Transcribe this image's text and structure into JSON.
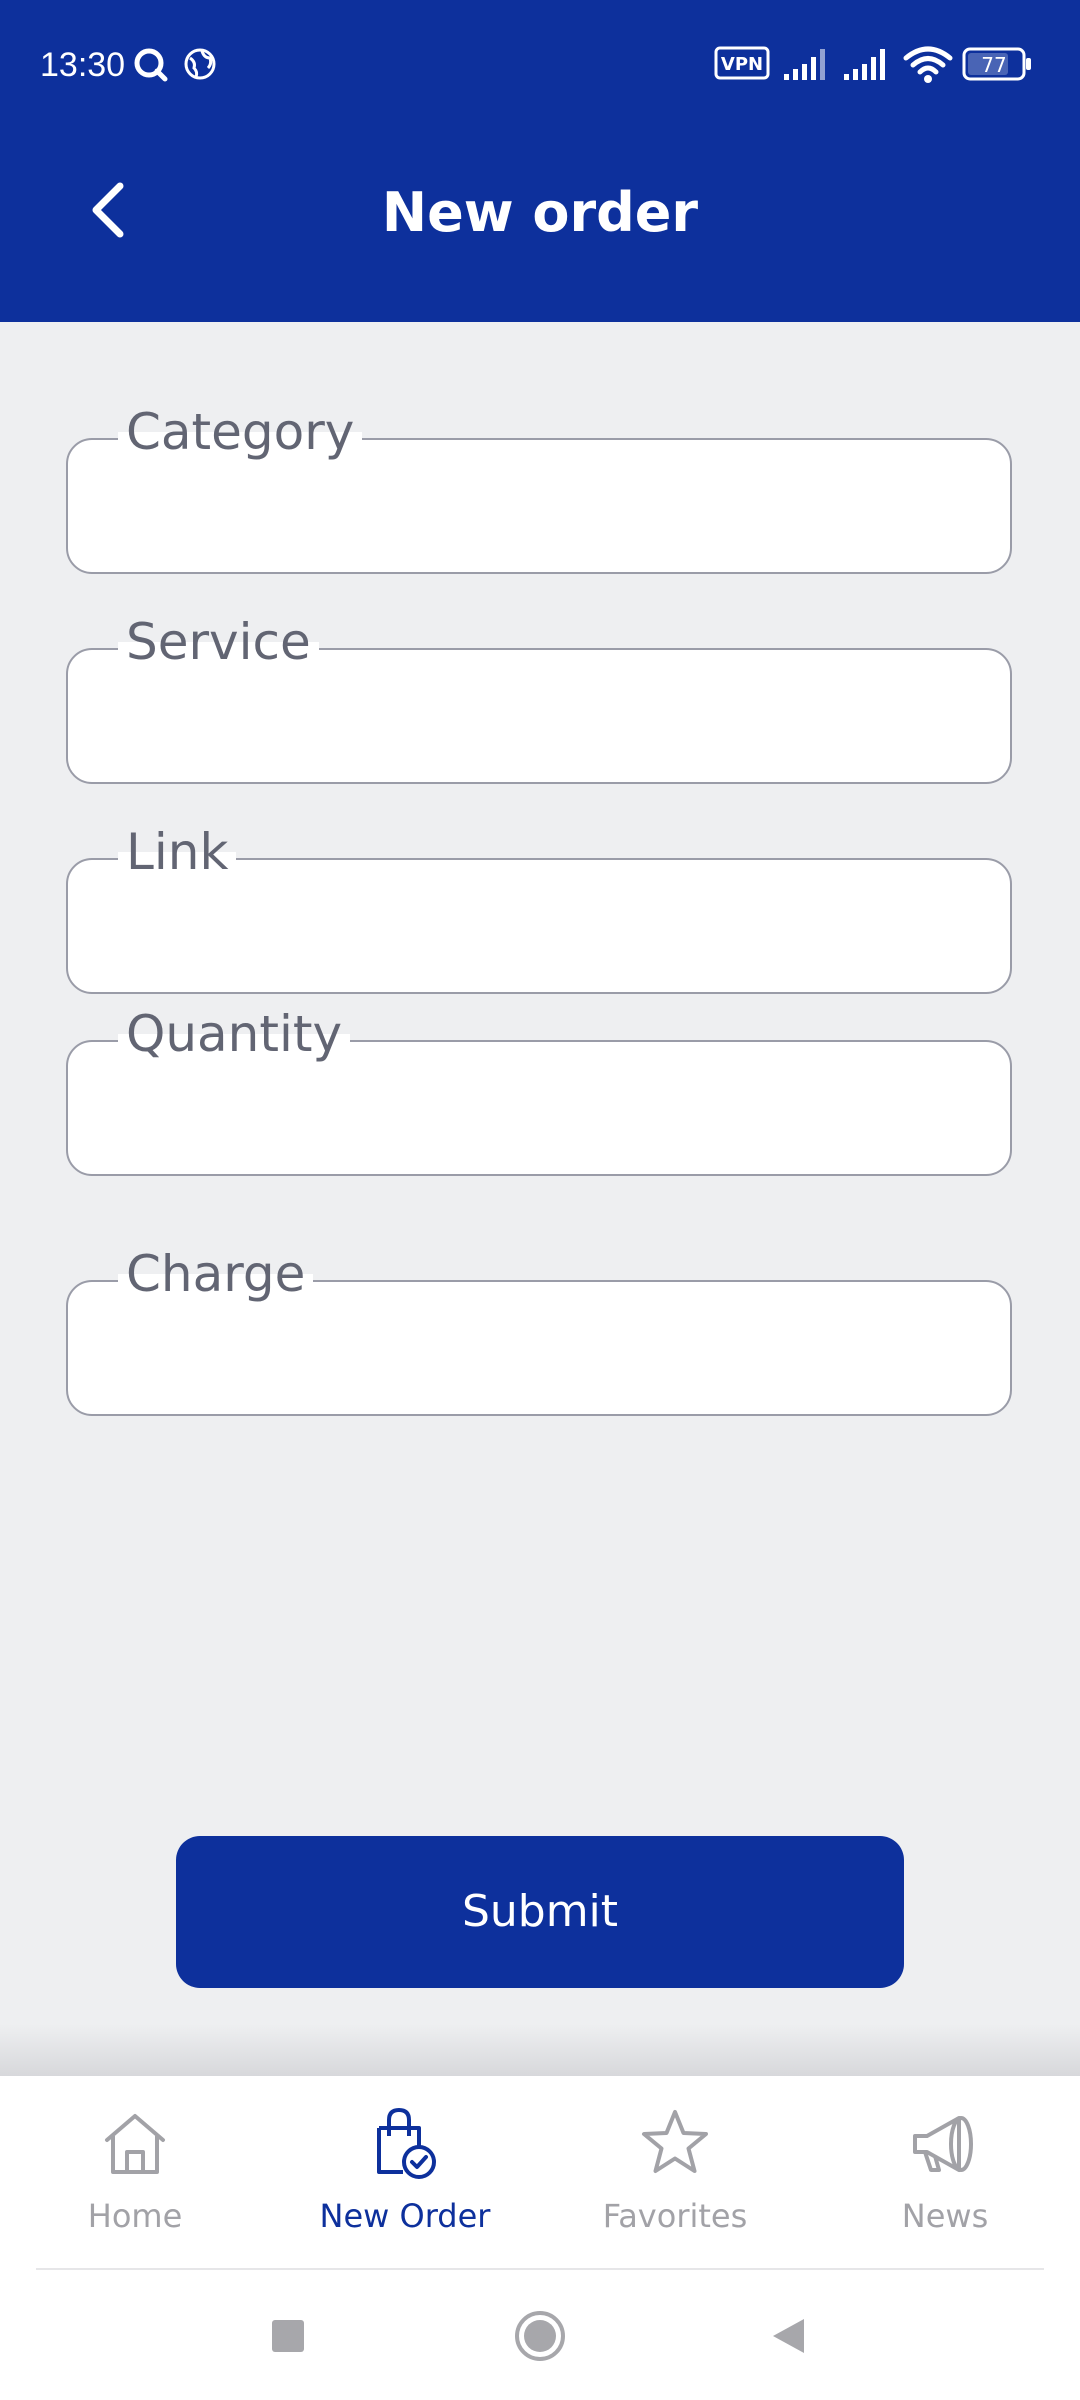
{
  "status_bar": {
    "time": "13:30",
    "vpn": "VPN",
    "battery": "77"
  },
  "header": {
    "title": "New order"
  },
  "form": {
    "fields": [
      {
        "label": "Category",
        "value": ""
      },
      {
        "label": "Service",
        "value": ""
      },
      {
        "label": "Link",
        "value": ""
      },
      {
        "label": "Quantity",
        "value": ""
      },
      {
        "label": "Charge",
        "value": ""
      }
    ],
    "submit_label": "Submit"
  },
  "bottom_nav": {
    "items": [
      {
        "label": "Home",
        "icon": "home-icon",
        "active": false
      },
      {
        "label": "New Order",
        "icon": "shopping-bag-check-icon",
        "active": true
      },
      {
        "label": "Favorites",
        "icon": "star-icon",
        "active": false
      },
      {
        "label": "News",
        "icon": "megaphone-icon",
        "active": false
      }
    ]
  },
  "colors": {
    "primary": "#0d309c",
    "background": "#eeeff1",
    "inactive": "#a2a2a7",
    "label": "#626573",
    "border": "#9a9ca8"
  }
}
